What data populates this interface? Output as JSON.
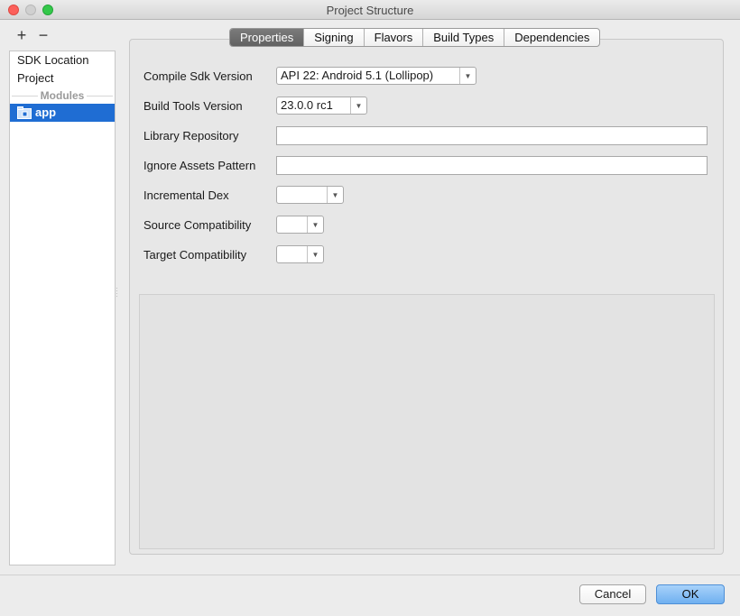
{
  "window": {
    "title": "Project Structure"
  },
  "toolbar": {
    "add_label": "+",
    "remove_label": "−"
  },
  "sidebar": {
    "items": [
      {
        "label": "SDK Location"
      },
      {
        "label": "Project"
      }
    ],
    "section_label": "Modules",
    "modules": [
      {
        "label": "app",
        "selected": true
      }
    ]
  },
  "tabs": [
    {
      "label": "Properties",
      "active": true
    },
    {
      "label": "Signing"
    },
    {
      "label": "Flavors"
    },
    {
      "label": "Build Types"
    },
    {
      "label": "Dependencies"
    }
  ],
  "properties": {
    "compile_sdk": {
      "label": "Compile Sdk Version",
      "value": "API 22: Android 5.1 (Lollipop)"
    },
    "build_tools": {
      "label": "Build Tools Version",
      "value": "23.0.0 rc1"
    },
    "library_repository": {
      "label": "Library Repository",
      "value": ""
    },
    "ignore_assets": {
      "label": "Ignore Assets Pattern",
      "value": ""
    },
    "incremental_dex": {
      "label": "Incremental Dex",
      "value": ""
    },
    "source_compat": {
      "label": "Source Compatibility",
      "value": ""
    },
    "target_compat": {
      "label": "Target Compatibility",
      "value": ""
    }
  },
  "buttons": {
    "cancel": "Cancel",
    "ok": "OK"
  },
  "colors": {
    "selection": "#1f6dd3",
    "ok_button": "#6fb0f0",
    "active_tab": "#6a6a6a"
  }
}
